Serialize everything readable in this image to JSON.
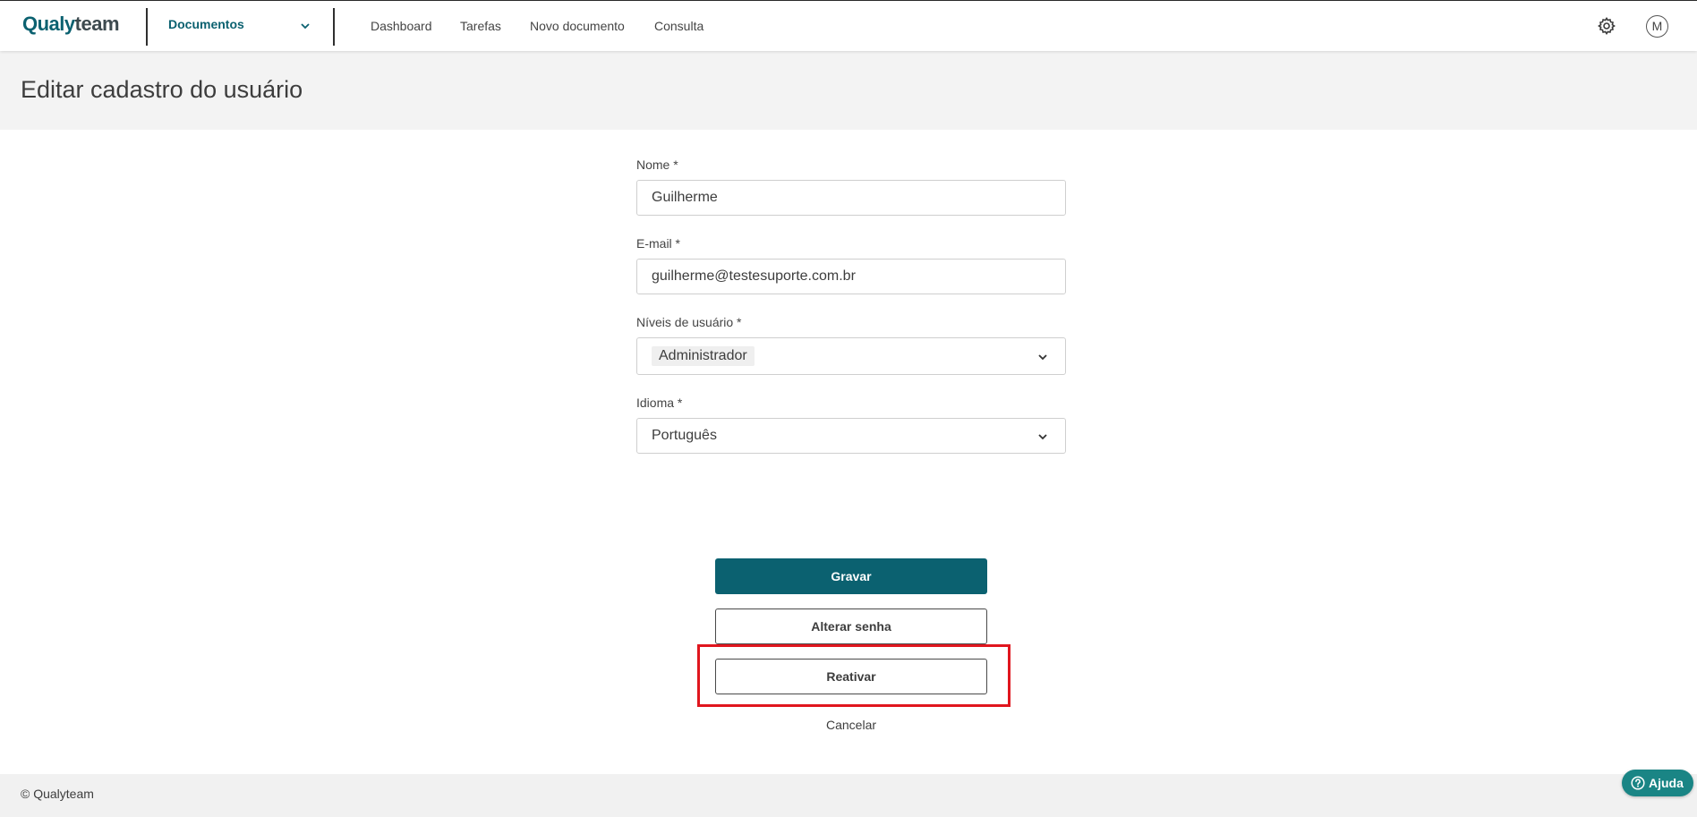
{
  "header": {
    "logo_part1": "Qualy",
    "logo_part2": "team",
    "module": "Documentos",
    "nav": [
      "Dashboard",
      "Tarefas",
      "Novo documento",
      "Consulta"
    ],
    "settings_icon": "gear-icon",
    "avatar_letter": "M"
  },
  "page": {
    "title": "Editar cadastro do usuário"
  },
  "form": {
    "name_label": "Nome *",
    "name_value": "Guilherme",
    "email_label": "E-mail *",
    "email_value": "guilherme@testesuporte.com.br",
    "levels_label": "Níveis de usuário *",
    "levels_selected": "Administrador",
    "language_label": "Idioma *",
    "language_value": "Português"
  },
  "actions": {
    "save": "Gravar",
    "change_password": "Alterar senha",
    "reactivate": "Reativar",
    "cancel": "Cancelar"
  },
  "footer": {
    "copyright": "© Qualyteam"
  },
  "help": {
    "label": "Ajuda"
  },
  "colors": {
    "brand": "#0b6170",
    "highlight": "#e0161e",
    "help": "#1a8585"
  }
}
